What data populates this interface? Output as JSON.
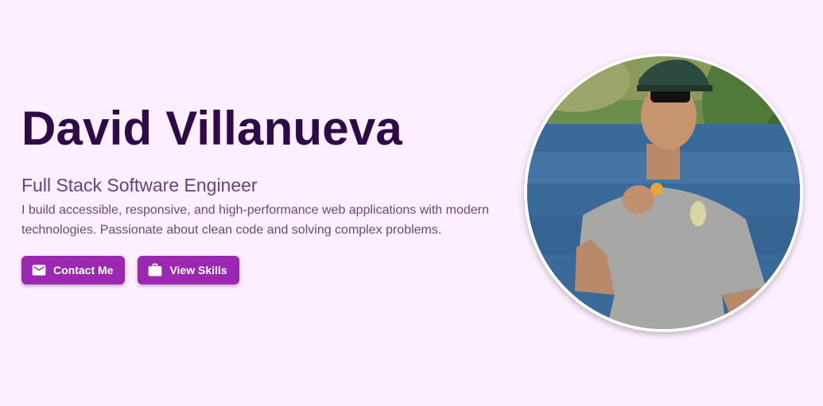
{
  "hero": {
    "name": "David Villanueva",
    "title": "Full Stack Software Engineer",
    "description": "I build accessible, responsive, and high-performance web applications with modern technologies. Passionate about clean code and solving complex problems."
  },
  "buttons": {
    "contact_label": "Contact Me",
    "contact_icon": "mail-icon",
    "skills_label": "View Skills",
    "skills_icon": "briefcase-icon"
  },
  "colors": {
    "background": "#fcefff",
    "name": "#2e0a48",
    "accent": "#9c27b0",
    "title": "#6b3f82"
  },
  "avatar": {
    "alt": "Profile photo"
  }
}
